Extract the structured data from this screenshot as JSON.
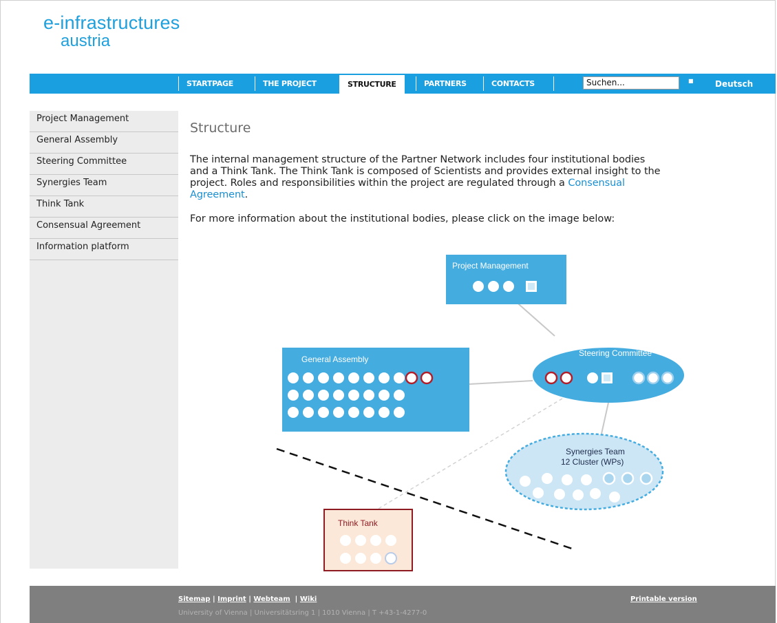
{
  "logo": {
    "line1": "e-infrastructures",
    "line2": "austria"
  },
  "nav": {
    "items": [
      {
        "label": "STARTPAGE",
        "active": false
      },
      {
        "label": "THE PROJECT",
        "active": false
      },
      {
        "label": "STRUCTURE",
        "active": true
      },
      {
        "label": "PARTNERS",
        "active": false
      },
      {
        "label": "CONTACTS",
        "active": false
      }
    ],
    "search_value": "Suchen...",
    "language": "Deutsch"
  },
  "sidebar": {
    "items": [
      {
        "label": "Project Management"
      },
      {
        "label": "General Assembly"
      },
      {
        "label": "Steering Committee"
      },
      {
        "label": "Synergies Team"
      },
      {
        "label": "Think Tank"
      },
      {
        "label": "Consensual Agreement"
      },
      {
        "label": "Information platform"
      }
    ]
  },
  "content": {
    "title": "Structure",
    "para1_line1": "The internal management structure of the Partner Network includes four institutional bodies",
    "para1_line2": "and a Think Tank. The Think Tank is composed of Scientists and provides external insight to the",
    "para1_line3": "project. Roles and responsibilities within the project are regulated through a ",
    "para1_link_a": "Consensual",
    "para1_link_b": "Agreement",
    "para1_end": ".",
    "para2": "For more information about the institutional bodies, please click on the image below:"
  },
  "diagram": {
    "project_management": "Project Management",
    "general_assembly": "General Assembly",
    "steering_committee": "Steering Committee",
    "synergies_team_line1": "Synergies Team",
    "synergies_team_line2": "12 Cluster (WPs)",
    "think_tank": "Think Tank",
    "colors": {
      "blue": "#45ace0",
      "red": "#b01f2a",
      "think_tank_fill": "#fce8d8"
    }
  },
  "footer": {
    "links": [
      "Sitemap",
      "Imprint",
      "Webteam",
      "Wiki"
    ],
    "address": "University of Vienna | Universitätsring 1 | 1010 Vienna | T +43-1-4277-0",
    "printable": "Printable version"
  }
}
